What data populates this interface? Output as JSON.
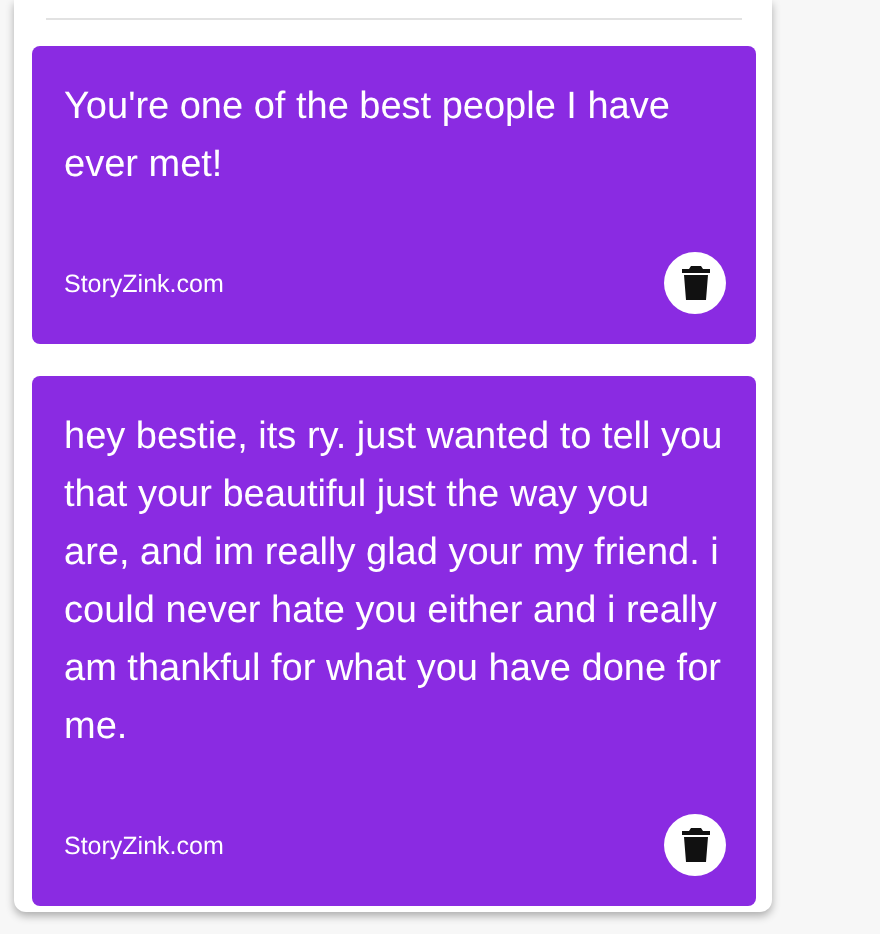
{
  "messages": [
    {
      "text": "You're one of the best people I have ever met!",
      "source": "StoryZink.com"
    },
    {
      "text": "hey bestie, its ry. just wanted to tell you that your beautiful just the way you are, and im really glad your my friend. i could never hate you either and i really am thankful for what you have done for me.",
      "source": "StoryZink.com"
    }
  ]
}
